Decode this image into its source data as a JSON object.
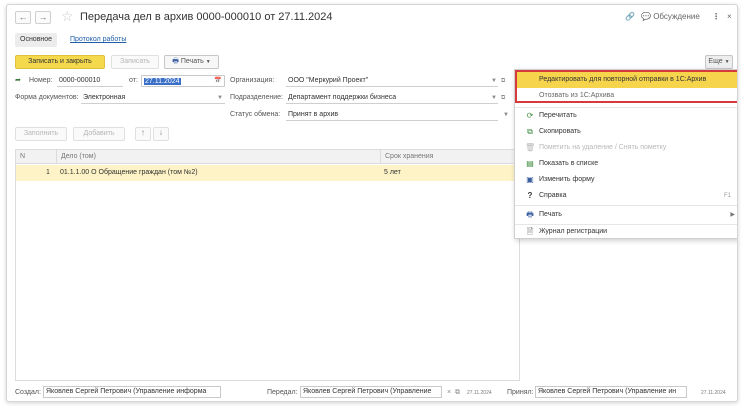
{
  "window": {
    "title": "Передача дел в архив 0000-000010 от 27.11.2024",
    "discussion_label": "Обсуждение"
  },
  "tabs": [
    {
      "label": "Основное"
    },
    {
      "label": "Протокол работы"
    }
  ],
  "toolbar": {
    "save_close": "Записать и закрыть",
    "save": "Записать",
    "print": "Печать",
    "more": "Еще"
  },
  "form": {
    "number_label": "Номер:",
    "number_value": "0000-000010",
    "date_label": "от:",
    "date_value": "27.11.2024",
    "org_label": "Организация:",
    "org_value": "ООО \"Меркурий Проект\"",
    "doc_form_label": "Форма документов:",
    "doc_form_value": "Электронная",
    "dept_label": "Подразделение:",
    "dept_value": "Департамент поддержки бизнеса",
    "status_label": "Статус обмена:",
    "status_value": "Принят в архив"
  },
  "table_toolbar": {
    "fill": "Заполнить",
    "add": "Добавить"
  },
  "table": {
    "columns": [
      "N",
      "Дело (том)",
      "Срок хранения"
    ],
    "rows": [
      {
        "n": "1",
        "case": "01.1.1.00 О Обращение граждан (том №2)",
        "retention": "5 лет"
      }
    ]
  },
  "menu": {
    "items": [
      {
        "icon": "none",
        "label": "Редактировать для повторной отправки в 1С:Архив",
        "state": "highlighted"
      },
      {
        "icon": "none",
        "label": "Отозвать из 1С:Архива",
        "state": "normal"
      },
      {
        "icon": "refresh-icon",
        "label": "Перечитать",
        "state": "normal"
      },
      {
        "icon": "copy-icon",
        "label": "Скопировать",
        "state": "normal"
      },
      {
        "icon": "delete-mark-icon",
        "label": "Пометить на удаление / Снять пометку",
        "state": "disabled"
      },
      {
        "icon": "list-icon",
        "label": "Показать в списке",
        "state": "normal"
      },
      {
        "icon": "form-icon",
        "label": "Изменить форму",
        "state": "normal"
      },
      {
        "icon": "help-icon",
        "label": "Справка",
        "state": "normal",
        "shortcut": "F1"
      },
      {
        "icon": "printer-icon",
        "label": "Печать",
        "state": "normal",
        "submenu": true
      },
      {
        "icon": "journal-icon",
        "label": "Журнал регистрации",
        "state": "normal"
      }
    ]
  },
  "footer": {
    "created_label": "Создал:",
    "created_value": "Яковлев Сергей Петрович (Управление информа",
    "sent_label": "Передал:",
    "sent_value": "Яковлев Сергей Петрович (Управление",
    "sent_date": "27.11.2024",
    "accepted_label": "Принял:",
    "accepted_value": "Яковлев Сергей Петрович (Управление ин",
    "accepted_date": "27.11.2024"
  },
  "colors": {
    "accent_yellow": "#f4d94c",
    "selection_blue": "#3a6fc7",
    "highlight_box": "#d63a3a",
    "row_highlight": "#fdf3c6"
  }
}
